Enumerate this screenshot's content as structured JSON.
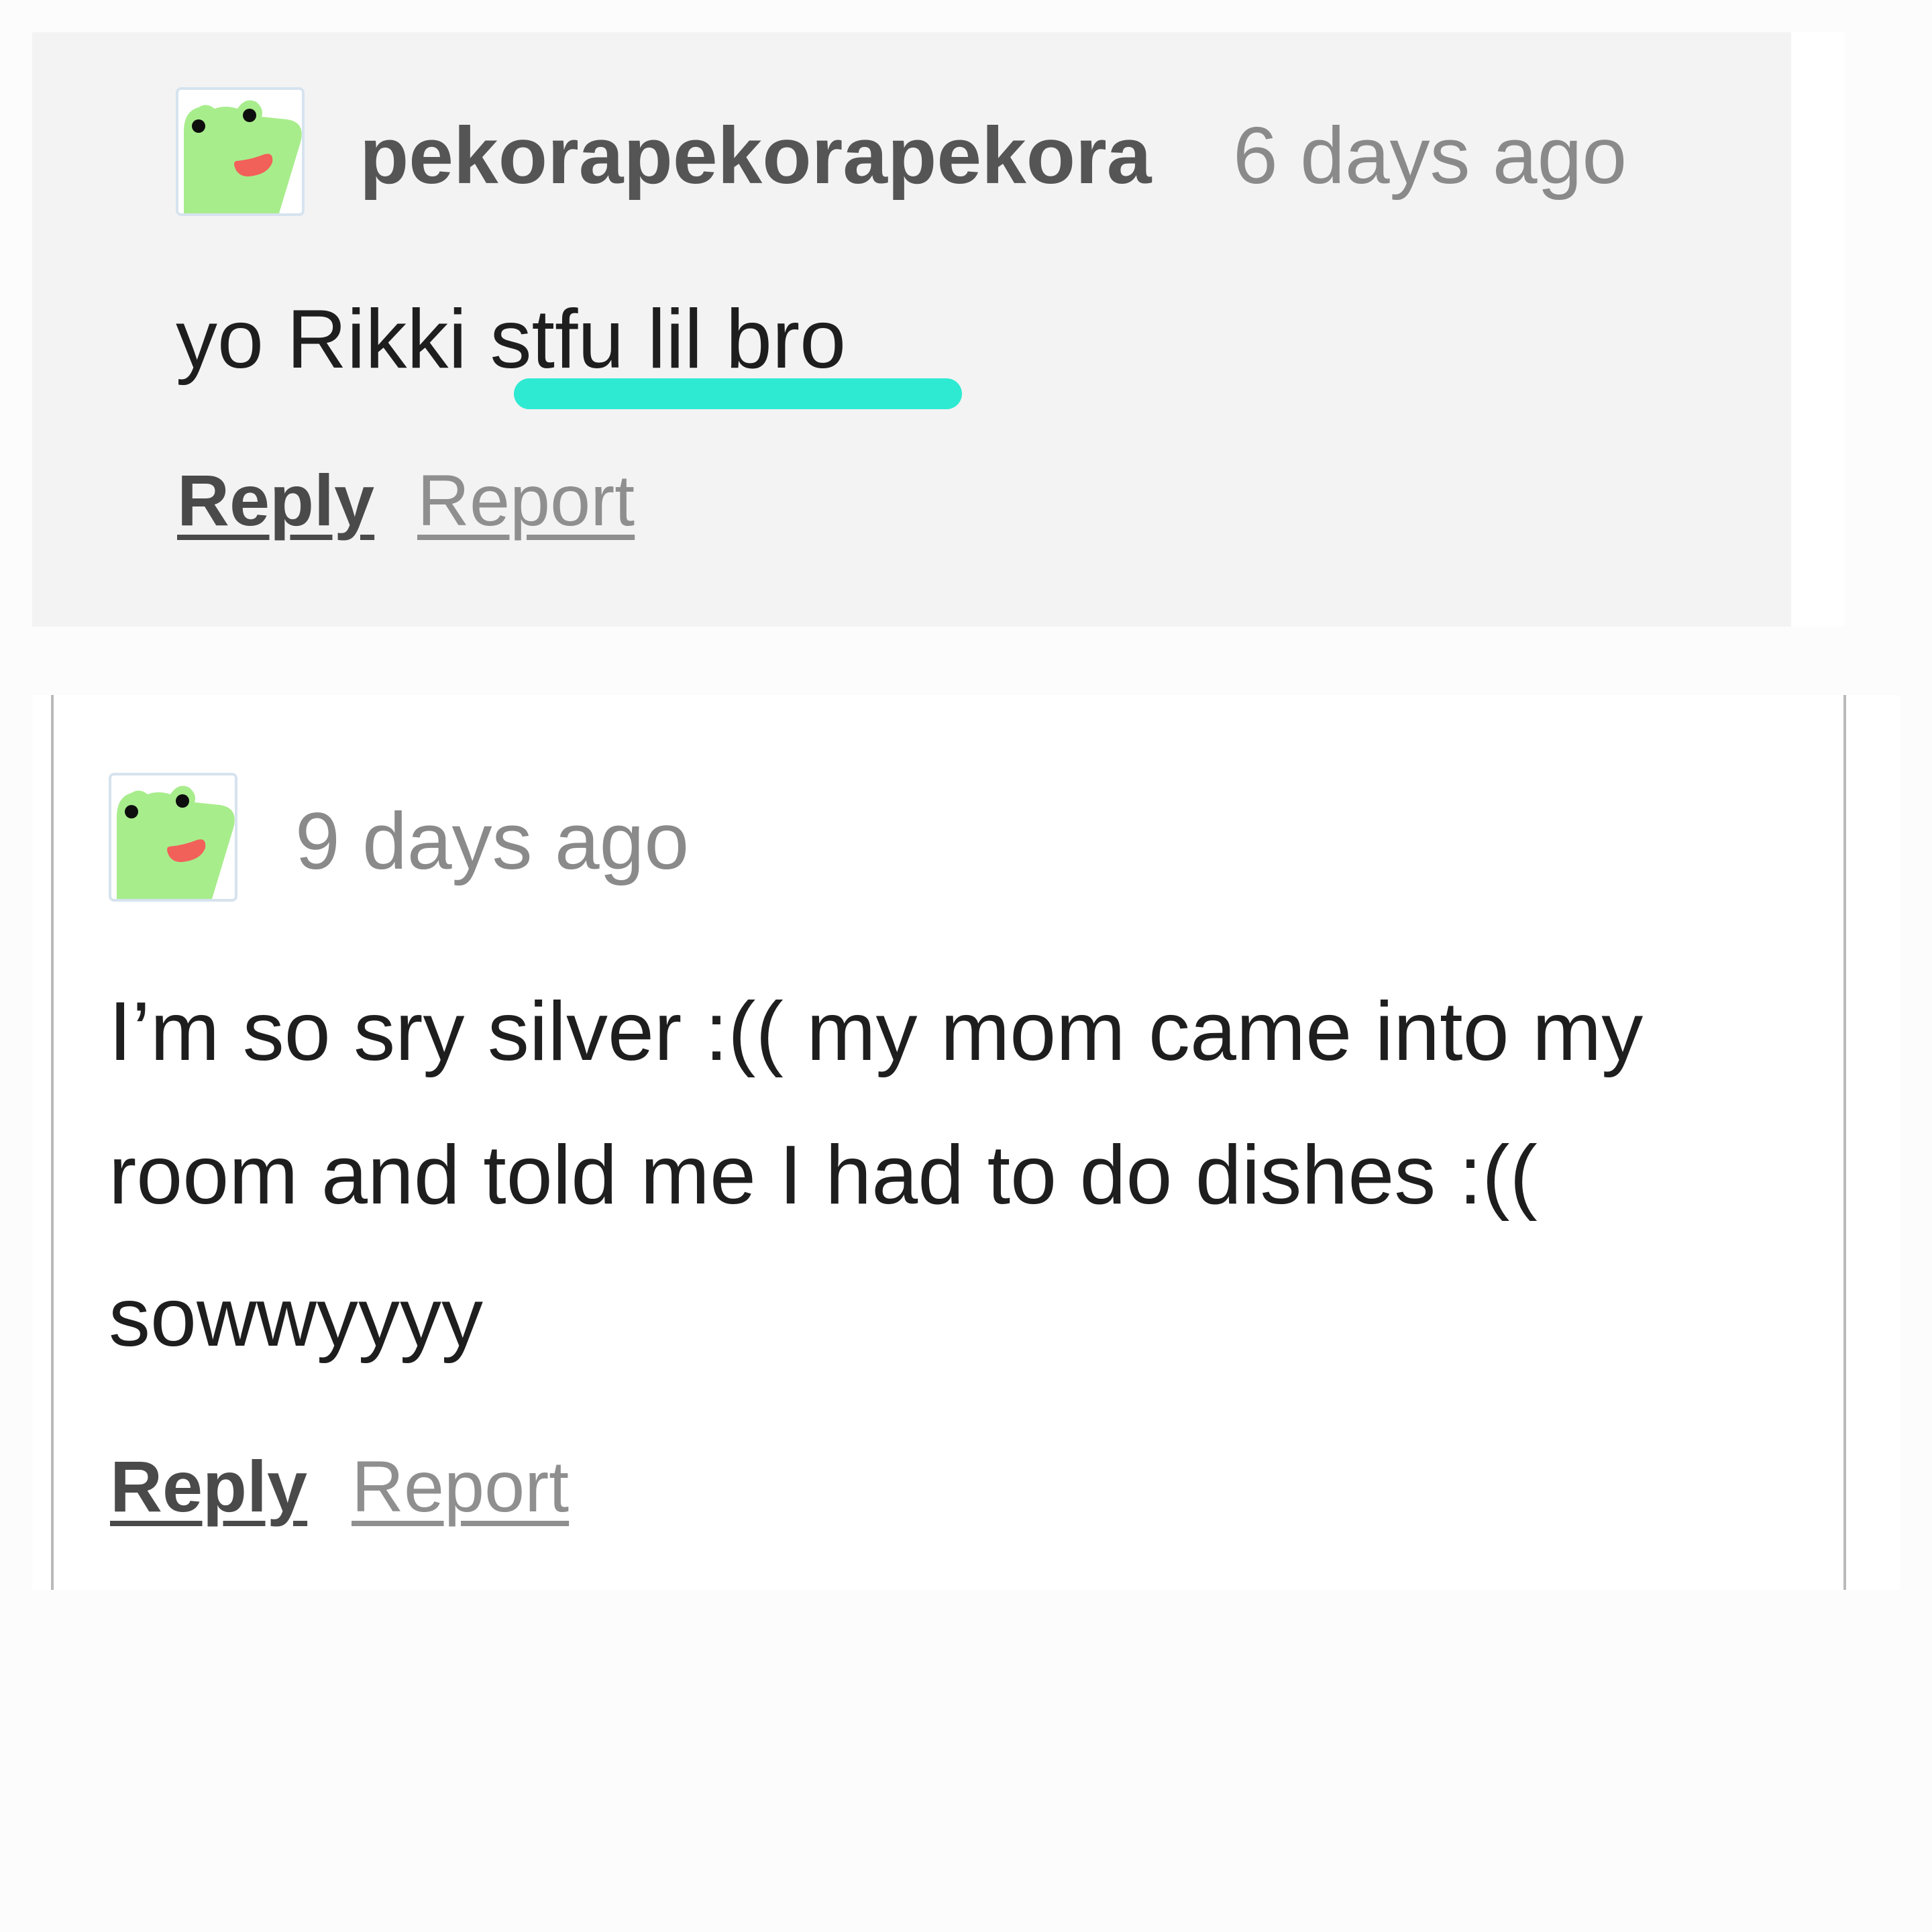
{
  "comments": [
    {
      "username": "pekorapekorapekora",
      "timestamp": "6 days ago",
      "body_lines": [
        "yo Rikki stfu lil bro"
      ],
      "actions": {
        "reply": "Reply",
        "report": "Report"
      },
      "avatar_icon": "frog-avatar-icon"
    },
    {
      "username": "",
      "timestamp": "9 days ago",
      "body_lines": [
        "I’m so sry silver :(( my mom came into my",
        "room and told me I had to do dishes :((",
        "sowwyyyy"
      ],
      "actions": {
        "reply": "Reply",
        "report": "Report"
      },
      "avatar_icon": "frog-avatar-icon"
    }
  ],
  "colors": {
    "highlight": "#2eead2",
    "avatar_face": "#a8ed8c",
    "avatar_mouth": "#f2605a"
  }
}
